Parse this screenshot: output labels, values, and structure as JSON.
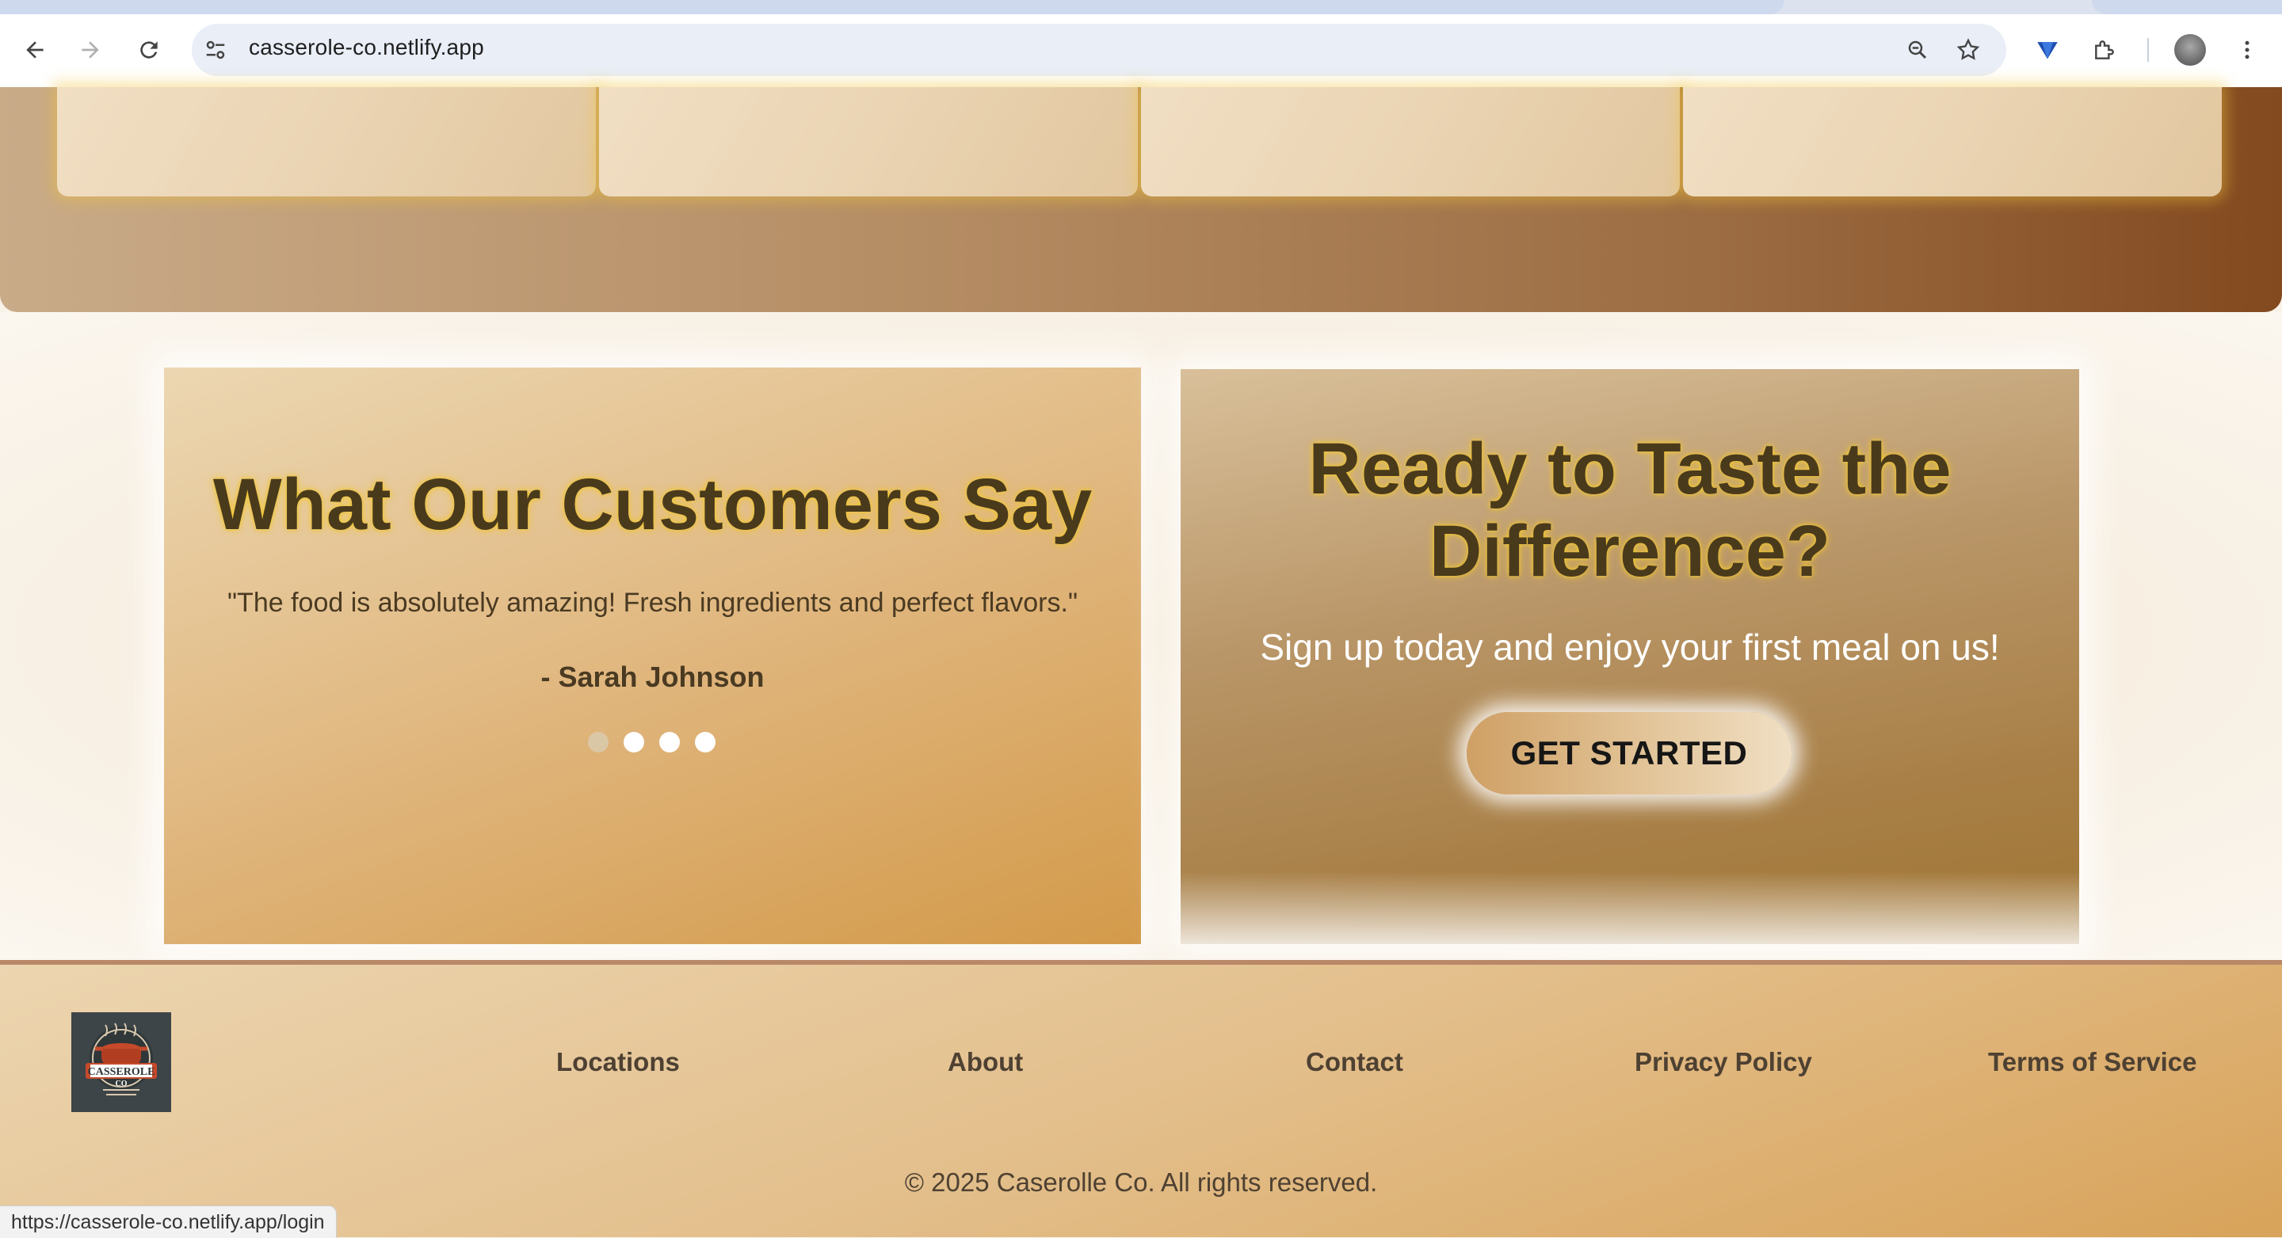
{
  "browser": {
    "url": "casserole-co.netlify.app",
    "status_url": "https://casserole-co.netlify.app/login"
  },
  "testimonials": {
    "title": "What Our Customers Say",
    "quote": "\"The food is absolutely amazing! Fresh ingredients and perfect flavors.\"",
    "author": "- Sarah Johnson",
    "dot_count": 4,
    "active_dot": 0
  },
  "cta": {
    "title_line1": "Ready to Taste the",
    "title_line2": "Difference?",
    "subtitle": "Sign up today and enjoy your first meal on us!",
    "button_label": "GET STARTED"
  },
  "footer": {
    "logo_text": "CASSEROLE CO",
    "links": [
      "Locations",
      "About",
      "Contact",
      "Privacy Policy",
      "Terms of Service"
    ],
    "copyright": "© 2025 Caserolle Co. All rights reserved."
  },
  "colors": {
    "title_text": "#4a3a1c",
    "title_glow": "#f1c630",
    "hero_dark": "#83491f",
    "footer_text": "#4e4132"
  }
}
